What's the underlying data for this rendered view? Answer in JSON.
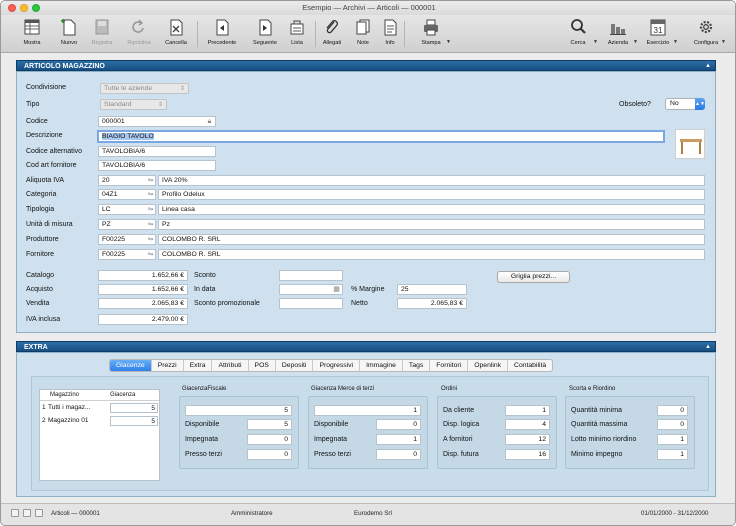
{
  "window": {
    "title": "Esempio — Archivi — Articoli — 000001"
  },
  "toolbar": {
    "buttons": [
      {
        "label": "Mostra",
        "icon": "grid-list-icon",
        "enabled": true
      },
      {
        "label": "Nuovo",
        "icon": "new-doc-icon",
        "enabled": true
      },
      {
        "label": "Registra",
        "icon": "save-icon",
        "enabled": false
      },
      {
        "label": "Ripristina",
        "icon": "revert-icon",
        "enabled": false
      },
      {
        "label": "Cancella",
        "icon": "delete-icon",
        "enabled": true
      },
      {
        "label": "Precedente",
        "icon": "previous-icon",
        "enabled": true
      },
      {
        "label": "Seguente",
        "icon": "next-icon",
        "enabled": true
      },
      {
        "label": "Lista",
        "icon": "list-icon",
        "enabled": true
      },
      {
        "label": "Allegati",
        "icon": "paperclip-icon",
        "enabled": true
      },
      {
        "label": "Note",
        "icon": "notes-icon",
        "enabled": true
      },
      {
        "label": "Info",
        "icon": "info-icon",
        "enabled": true
      },
      {
        "label": "Stampa",
        "icon": "printer-icon",
        "enabled": true
      },
      {
        "label": "Cerca",
        "icon": "search-icon",
        "enabled": true
      },
      {
        "label": "Azienda",
        "icon": "company-icon",
        "enabled": true
      },
      {
        "label": "Esercizio",
        "icon": "calendar-icon",
        "enabled": true
      },
      {
        "label": "Configura",
        "icon": "gear-icon",
        "enabled": true
      }
    ],
    "calendar_day": "31"
  },
  "articolo": {
    "section_title": "ARTICOLO MAGAZZINO",
    "condivisione": {
      "label": "Condivisione",
      "value": "Tutte le aziende"
    },
    "tipo": {
      "label": "Tipo",
      "value": "Standard"
    },
    "obsoleto": {
      "label": "Obsoleto?",
      "value": "No"
    },
    "codice": {
      "label": "Codice",
      "value": "000001"
    },
    "descrizione": {
      "label": "Descrizione",
      "value": "BIAGIO TAVOLO"
    },
    "codice_alternativo": {
      "label": "Codice alternativo",
      "value": "TAVOLOBIA/6"
    },
    "cod_art_fornitore": {
      "label": "Cod art fornitore",
      "value": "TAVOLOBIA/6"
    },
    "aliquota_iva": {
      "label": "Aliquota IVA",
      "code": "20",
      "desc": "IVA 20%"
    },
    "categoria": {
      "label": "Categoria",
      "code": "04Z1",
      "desc": "Profilo Odelux"
    },
    "tipologia": {
      "label": "Tipologia",
      "code": "LC",
      "desc": "Linea casa"
    },
    "unita_misura": {
      "label": "Unità di misura",
      "code": "PZ",
      "desc": "Pz"
    },
    "produttore": {
      "label": "Produttore",
      "code": "F00225",
      "desc": "COLOMBO R. SRL"
    },
    "fornitore": {
      "label": "Fornitore",
      "code": "F00225",
      "desc": "COLOMBO R. SRL"
    },
    "catalogo": {
      "label": "Catalogo",
      "value": "1.652,66 €"
    },
    "acquisto": {
      "label": "Acquisto",
      "value": "1.652,66 €"
    },
    "vendita": {
      "label": "Vendita",
      "value": "2.065,83 €"
    },
    "iva_inclusa": {
      "label": "IVA inclusa",
      "value": "2.479,00 €"
    },
    "sconto": {
      "label": "Sconto",
      "value": ""
    },
    "in_data": {
      "label": "In data",
      "value": ""
    },
    "sconto_promozionale": {
      "label": "Sconto promozionale",
      "value": ""
    },
    "margine": {
      "label": "% Margine",
      "value": "25"
    },
    "netto": {
      "label": "Netto",
      "value": "2.065,83 €"
    },
    "griglia_prezzi": "Griglia prezzi..."
  },
  "extra": {
    "section_title": "EXTRA",
    "tabs": [
      "Giacenze",
      "Prezzi",
      "Extra",
      "Attributi",
      "POS",
      "Depositi",
      "Progressivi",
      "Immagine",
      "Tags",
      "Fornitori",
      "Openlink",
      "Contabilità"
    ],
    "table": {
      "headers": [
        "Magazzino",
        "Giacenza"
      ],
      "rows": [
        {
          "num": "1",
          "name": "Tutti i magaz...",
          "qty": "5"
        },
        {
          "num": "2",
          "name": "Magazzino 01",
          "qty": "5"
        }
      ]
    },
    "giacenza_fiscale": {
      "title": "GiacenzaFiscale",
      "total": "5",
      "disponibile": {
        "label": "Disponibile",
        "value": "5"
      },
      "impegnata": {
        "label": "Impegnata",
        "value": "0"
      },
      "presso_terzi": {
        "label": "Presso terzi",
        "value": "0"
      }
    },
    "giacenza_terzi": {
      "title": "Giacenza Merce di terzi",
      "total": "1",
      "disponibile": {
        "label": "Disponibile",
        "value": "0"
      },
      "impegnata": {
        "label": "Impegnata",
        "value": "1"
      },
      "presso_terzi": {
        "label": "Presso terzi",
        "value": "0"
      }
    },
    "ordini": {
      "title": "Ordini",
      "da_cliente": {
        "label": "Da cliente",
        "value": "1"
      },
      "disp_logica": {
        "label": "Disp. logica",
        "value": "4"
      },
      "a_fornitori": {
        "label": "A fornitori",
        "value": "12"
      },
      "disp_futura": {
        "label": "Disp. futura",
        "value": "16"
      }
    },
    "scorta": {
      "title": "Scorta e Riordino",
      "quantita_minima": {
        "label": "Quantità minima",
        "value": "0"
      },
      "quantita_massima": {
        "label": "Quantità massima",
        "value": "0"
      },
      "lotto_minimo": {
        "label": "Lotto minimo riordino",
        "value": "1"
      },
      "minimo_impegno": {
        "label": "Minimo impegno",
        "value": "1"
      }
    }
  },
  "status": {
    "record": "Articoli — 000001",
    "user": "Amministratore",
    "company": "Eurodemo Srl",
    "period": "01/01/2000 - 31/12/2000"
  },
  "colors": {
    "accent": "#2f80ea",
    "section_bar": "#1f5f96",
    "panel_bg": "#cfe1ee"
  }
}
